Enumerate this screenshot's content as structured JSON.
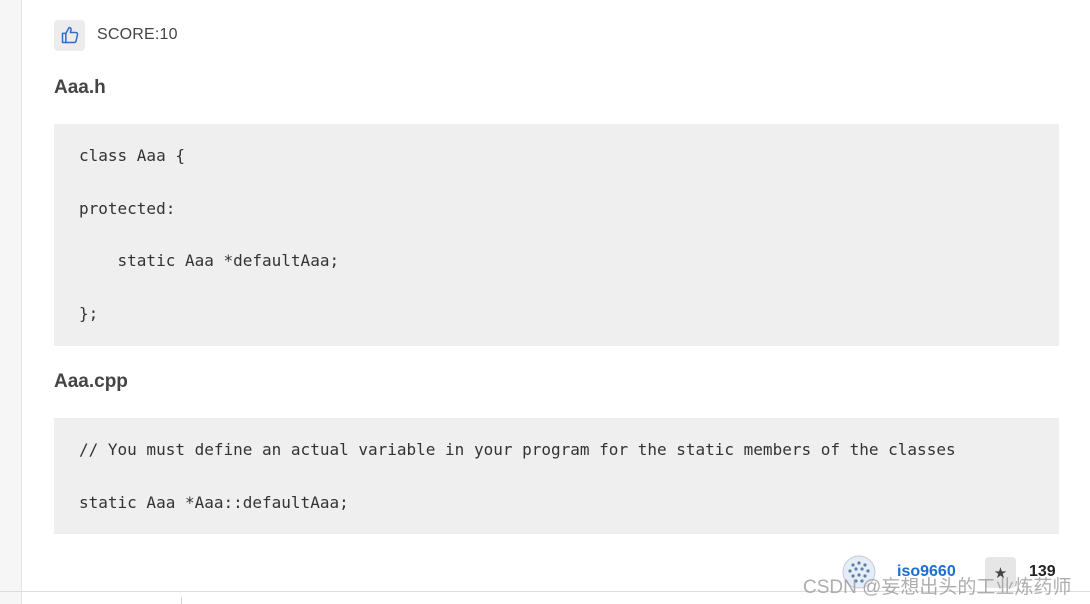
{
  "vote": {
    "icon": "thumbs-up-icon",
    "score_text": "SCORE:10"
  },
  "sections": [
    {
      "heading": "Aaa.h",
      "code_lines": [
        "class Aaa {",
        "protected:",
        "    static Aaa *defaultAaa;",
        "};"
      ]
    },
    {
      "heading": "Aaa.cpp",
      "code_lines": [
        "// You must define an actual variable in your program for the static members of the classes",
        "static Aaa *Aaa::defaultAaa;"
      ]
    }
  ],
  "author": {
    "avatar_icon": "avatar-icon",
    "username": "iso9660"
  },
  "favorite": {
    "icon": "star-icon",
    "count": "139"
  },
  "watermark": "CSDN @妄想出头的工业炼药师",
  "colors": {
    "code_background": "#efefef",
    "link": "#1a6fd0",
    "thumb_icon": "#2f6bd0"
  }
}
